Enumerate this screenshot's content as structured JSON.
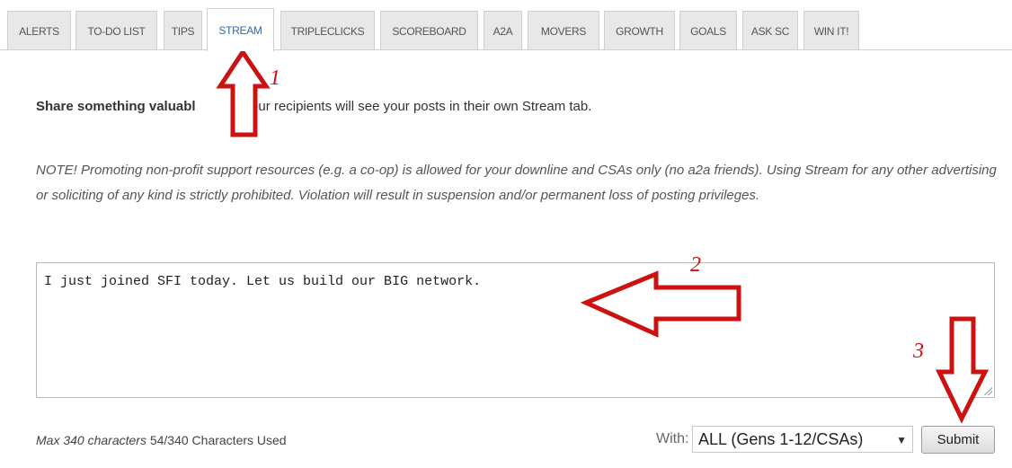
{
  "tabs": [
    {
      "label": "ALERTS",
      "active": false
    },
    {
      "label": "TO-DO LIST",
      "active": false
    },
    {
      "label": "TIPS",
      "active": false
    },
    {
      "label": "STREAM",
      "active": true
    },
    {
      "label": "TRIPLECLICKS",
      "active": false
    },
    {
      "label": "SCOREBOARD",
      "active": false
    },
    {
      "label": "A2A",
      "active": false
    },
    {
      "label": "MOVERS",
      "active": false
    },
    {
      "label": "GROWTH",
      "active": false
    },
    {
      "label": "GOALS",
      "active": false
    },
    {
      "label": "ASK SC",
      "active": false
    },
    {
      "label": "WIN IT!",
      "active": false
    }
  ],
  "share": {
    "bold": "Share something valuabl",
    "rest": "your recipients will see your posts in their own Stream tab."
  },
  "note": "NOTE! Promoting non-profit support resources (e.g. a co-op) is allowed for your downline and CSAs only (no a2a friends). Using Stream for any other advertising or soliciting of any kind is strictly prohibited. Violation will result in suspension and/or permanent loss of posting privileges.",
  "post": {
    "text": "I just joined SFI today. Let us build our BIG network."
  },
  "counter": {
    "max": "Max 340 characters",
    "used": "54/340 Characters Used"
  },
  "with": {
    "label": "With:",
    "selected": "ALL (Gens 1-12/CSAs)"
  },
  "submit_label": "Submit",
  "annotations": {
    "one": "1",
    "two": "2",
    "three": "3",
    "color": "#cc1111"
  }
}
